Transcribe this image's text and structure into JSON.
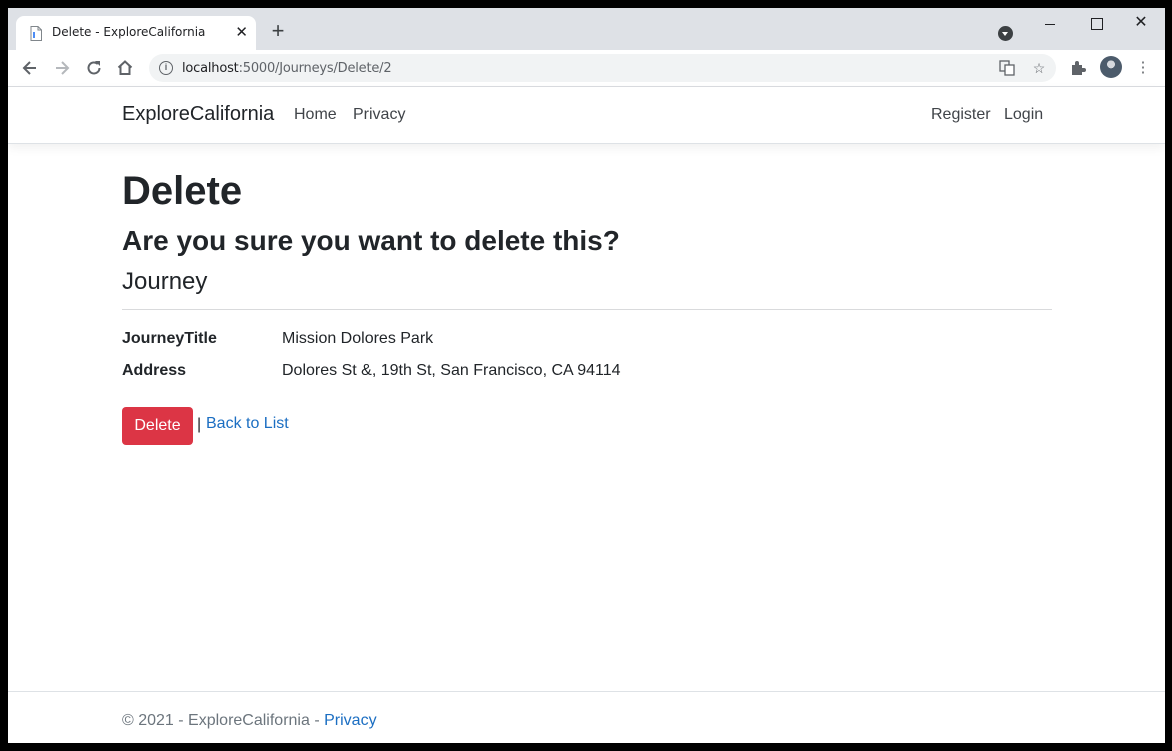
{
  "browser": {
    "tab_title": "Delete - ExploreCalifornia",
    "url_host": "localhost",
    "url_path": ":5000/Journeys/Delete/2",
    "new_tab": "+",
    "close_tab": "✕"
  },
  "navbar": {
    "brand": "ExploreCalifornia",
    "links": [
      {
        "label": "Home"
      },
      {
        "label": "Privacy"
      }
    ],
    "right_links": [
      {
        "label": "Register"
      },
      {
        "label": "Login"
      }
    ]
  },
  "page": {
    "title": "Delete",
    "question": "Are you sure you want to delete this?",
    "entity": "Journey",
    "fields": [
      {
        "label": "JourneyTitle",
        "value": "Mission Dolores Park"
      },
      {
        "label": "Address",
        "value": "Dolores St &, 19th St, San Francisco, CA 94114"
      }
    ],
    "delete_button": "Delete",
    "separator": "|",
    "back_link": "Back to List"
  },
  "footer": {
    "text": "© 2021 - ExploreCalifornia - ",
    "privacy_link": "Privacy"
  },
  "colors": {
    "danger": "#dc3545",
    "link": "#1b6ec2"
  }
}
